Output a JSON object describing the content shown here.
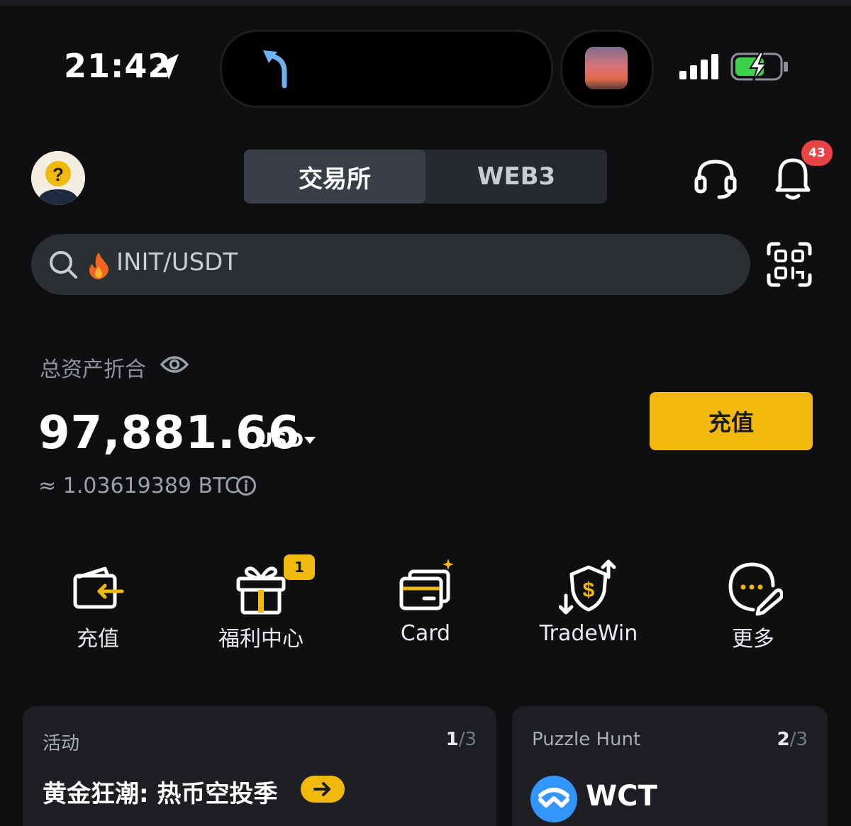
{
  "status_bar": {
    "time": "21:42"
  },
  "header": {
    "tabs": [
      {
        "label": "交易所",
        "active": true
      },
      {
        "label": "WEB3",
        "active": false
      }
    ],
    "notification_count": "43"
  },
  "search": {
    "placeholder": "INIT/USDT"
  },
  "assets": {
    "label": "总资产折合",
    "balance": "97,881.66",
    "currency": "USD",
    "btc_equivalent": "≈ 1.03619389 BTC",
    "deposit_label": "充值"
  },
  "quick_actions": [
    {
      "label": "充值",
      "icon": "wallet-deposit-icon"
    },
    {
      "label": "福利中心",
      "icon": "gift-icon",
      "badge": "1"
    },
    {
      "label": "Card",
      "icon": "card-icon"
    },
    {
      "label": "TradeWin",
      "icon": "tradewin-shield-icon"
    },
    {
      "label": "更多",
      "icon": "more-icon"
    }
  ],
  "cards": [
    {
      "title": "活动",
      "page_current": "1",
      "page_total": "/3",
      "headline": "黄金狂潮: 热币空投季"
    },
    {
      "title": "Puzzle Hunt",
      "page_current": "2",
      "page_total": "/3",
      "headline": "WCT"
    }
  ],
  "colors": {
    "accent": "#f0b90b",
    "background": "#0f0f12",
    "badge_red": "#e84242"
  }
}
